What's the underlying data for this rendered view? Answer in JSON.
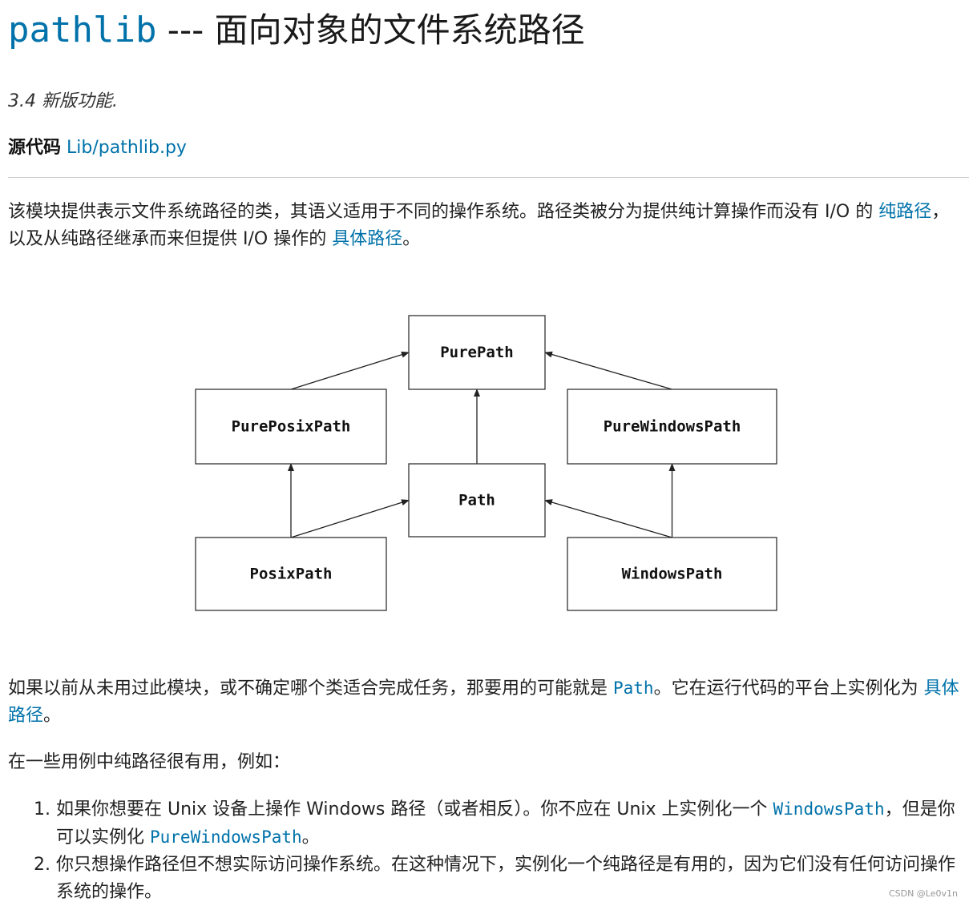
{
  "header": {
    "module_name": "pathlib",
    "title_rest": " --- 面向对象的文件系统路径"
  },
  "version_note": "3.4 新版功能.",
  "source": {
    "label": "源代码",
    "link_text": "Lib/pathlib.py"
  },
  "intro": {
    "text1": "该模块提供表示文件系统路径的类，其语义适用于不同的操作系统。路径类被分为提供纯计算操作而没有 I/O 的 ",
    "link1": "纯路径",
    "text2": "，以及从纯路径继承而来但提供 I/O 操作的 ",
    "link2": "具体路径",
    "text3": "。"
  },
  "diagram": {
    "nodes": [
      {
        "id": "purepath",
        "label": "PurePath"
      },
      {
        "id": "pureposixpath",
        "label": "PurePosixPath"
      },
      {
        "id": "purewindowspath",
        "label": "PureWindowsPath"
      },
      {
        "id": "path",
        "label": "Path"
      },
      {
        "id": "posixpath",
        "label": "PosixPath"
      },
      {
        "id": "windowspath",
        "label": "WindowsPath"
      }
    ],
    "edges": [
      {
        "from": "pureposixpath",
        "to": "purepath"
      },
      {
        "from": "purewindowspath",
        "to": "purepath"
      },
      {
        "from": "path",
        "to": "purepath"
      },
      {
        "from": "posixpath",
        "to": "pureposixpath"
      },
      {
        "from": "posixpath",
        "to": "path"
      },
      {
        "from": "windowspath",
        "to": "purewindowspath"
      },
      {
        "from": "windowspath",
        "to": "path"
      }
    ]
  },
  "para2": {
    "text1": "如果以前从未用过此模块，或不确定哪个类适合完成任务，那要用的可能就是 ",
    "code1": "Path",
    "text2": "。它在运行代码的平台上实例化为 ",
    "link1": "具体路径",
    "text3": "。"
  },
  "para3": "在一些用例中纯路径很有用，例如：",
  "list": [
    {
      "text1": "如果你想要在 Unix 设备上操作 Windows 路径（或者相反）。你不应在 Unix 上实例化一个 ",
      "code1": "WindowsPath",
      "text2": "，但是你可以实例化 ",
      "code2": "PureWindowsPath",
      "text3": "。"
    },
    {
      "text1": "你只想操作路径但不想实际访问操作系统。在这种情况下，实例化一个纯路径是有用的，因为它们没有任何访问操作系统的操作。"
    }
  ],
  "watermark": "CSDN @Le0v1n",
  "colors": {
    "link": "#0072aa",
    "text": "#222222",
    "rule": "#cccccc"
  }
}
